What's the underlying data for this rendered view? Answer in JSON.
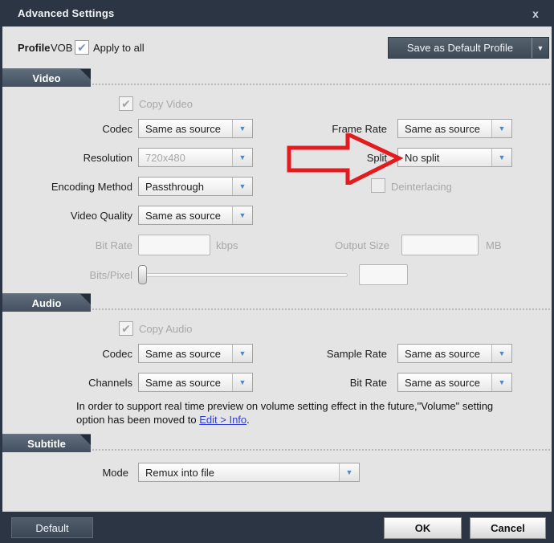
{
  "window": {
    "title": "Advanced Settings"
  },
  "icons": {
    "close": "x",
    "check": "✔",
    "arrow_down": "▼"
  },
  "profile_bar": {
    "profile_label": "Profile",
    "profile_value": "VOB",
    "apply_to_all_label": "Apply to all",
    "save_default_label": "Save as Default Profile"
  },
  "video": {
    "section_label": "Video",
    "copy_video_label": "Copy Video",
    "codec_label": "Codec",
    "codec_value": "Same as source",
    "frame_rate_label": "Frame Rate",
    "frame_rate_value": "Same as source",
    "resolution_label": "Resolution",
    "resolution_value": "720x480",
    "split_label": "Split",
    "split_value": "No split",
    "encoding_method_label": "Encoding Method",
    "encoding_method_value": "Passthrough",
    "deinterlacing_label": "Deinterlacing",
    "video_quality_label": "Video Quality",
    "video_quality_value": "Same as source",
    "bit_rate_label": "Bit Rate",
    "bit_rate_value": "",
    "bit_rate_unit": "kbps",
    "output_size_label": "Output Size",
    "output_size_value": "",
    "output_size_unit": "MB",
    "bits_pixel_label": "Bits/Pixel",
    "bits_pixel_value": ""
  },
  "audio": {
    "section_label": "Audio",
    "copy_audio_label": "Copy Audio",
    "codec_label": "Codec",
    "codec_value": "Same as source",
    "sample_rate_label": "Sample Rate",
    "sample_rate_value": "Same as source",
    "channels_label": "Channels",
    "channels_value": "Same as source",
    "bit_rate_label": "Bit Rate",
    "bit_rate_value": "Same as source"
  },
  "note": {
    "text": "In order to support real time preview on volume setting effect in the future,\"Volume\" setting option has been moved to ",
    "link_label": "Edit > Info",
    "suffix": "."
  },
  "subtitle": {
    "section_label": "Subtitle",
    "mode_label": "Mode",
    "mode_value": "Remux into file"
  },
  "footer": {
    "default_label": "Default",
    "ok_label": "OK",
    "cancel_label": "Cancel"
  },
  "colors": {
    "titlebar": "#2c3543",
    "content_bg": "#e4e4e4",
    "tab": "#4c5866",
    "dropdown_arrow": "#4f86c6",
    "link": "#3140d2",
    "annotation_arrow": "#e31b1f"
  }
}
